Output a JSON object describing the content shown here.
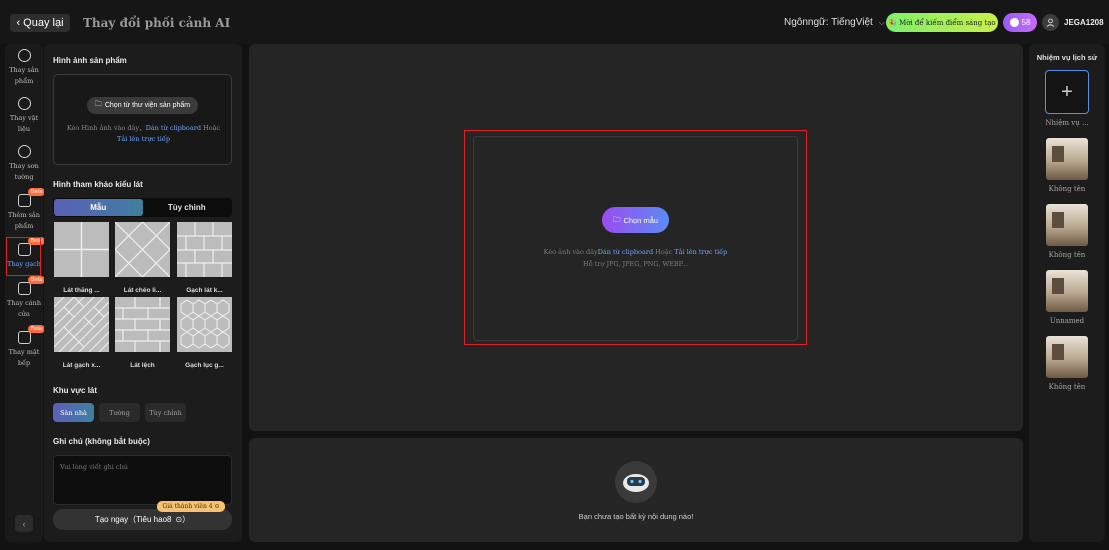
{
  "header": {
    "back_label": "Quay lại",
    "title": "Thay đổi phối cảnh AI",
    "language_label": "Ngônngữ: TiếngViệt",
    "invite_label": "Mời để kiếm điểm sáng tạo",
    "credits": "58",
    "username": "JEGA1208"
  },
  "nav": {
    "items": [
      {
        "label": "Thay sản phẩm",
        "beta": false
      },
      {
        "label": "Thay vật liệu",
        "beta": false
      },
      {
        "label": "Thay sơn tường",
        "beta": false
      },
      {
        "label": "Thêm sản phẩm",
        "beta": true
      },
      {
        "label": "Thay gạch",
        "beta": true
      },
      {
        "label": "Thay cánh cửa",
        "beta": true
      },
      {
        "label": "Thay mặt bếp",
        "beta": true
      }
    ],
    "beta_label": "Beta",
    "active_index": 4
  },
  "panel": {
    "product_image_title": "Hình ảnh sản phẩm",
    "library_button": "Chọn từ thư viện sản phẩm",
    "upload_hint_prefix": "Kéo Hình ảnh vào đây，",
    "upload_hint_clipboard": "Dán từ clipboard",
    "upload_hint_or": " Hoặc",
    "upload_hint_direct": "Tải lên trực tiếp",
    "pattern_title": "Hình tham khảo kiểu lát",
    "tabs": [
      "Mẫu",
      "Tùy chỉnh"
    ],
    "patterns": [
      "Lát thẳng ...",
      "Lát chéo li...",
      "Gạch lát k...",
      "Lát gạch x...",
      "Lát lệch",
      "Gạch lục g..."
    ],
    "area_title": "Khu vực lát",
    "areas": [
      "Sàn nhà",
      "Tường",
      "Tùy chỉnh"
    ],
    "note_title": "Ghi chú (không bắt buộc)",
    "note_placeholder": "Vui lòng viết ghi chú",
    "price_tag": "Giá thành viên 4",
    "create_button": "Tạo ngay（Tiêu hao8"
  },
  "canvas": {
    "choose_button": "Chọn mẫu",
    "hint_prefix": "Kéo ảnh vào đây",
    "hint_clipboard": "Dán từ clipboard",
    "hint_or": " Hoặc ",
    "hint_direct": "Tải lên trực tiếp",
    "hint_formats": "Hỗ trợ JPG, JPEG, PNG, WEBP..."
  },
  "result": {
    "empty_text": "Bạn chưa tạo bất kỳ nội dung nào!"
  },
  "history": {
    "title": "Nhiệm vụ lịch sử",
    "new_task_label": "Nhiệm vụ ...",
    "items": [
      "Không tên",
      "Không tên",
      "Unnamed",
      "Không tên"
    ]
  }
}
